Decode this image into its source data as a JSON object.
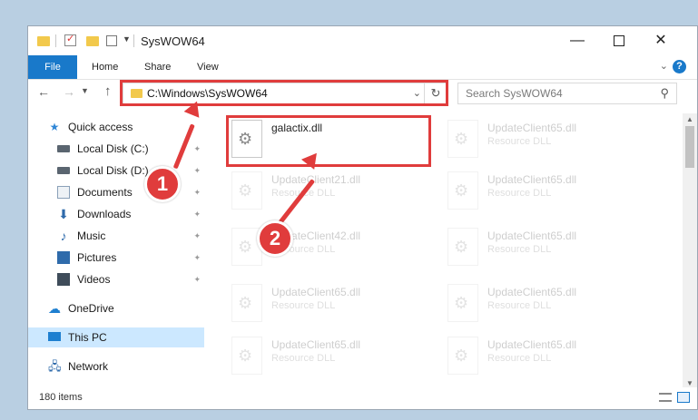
{
  "window": {
    "title": "SysWOW64"
  },
  "ribbon": {
    "tabs": [
      "File",
      "Home",
      "Share",
      "View"
    ],
    "help": "?"
  },
  "address": {
    "path": "C:\\Windows\\SysWOW64"
  },
  "search": {
    "placeholder": "Search SysWOW64"
  },
  "sidebar": {
    "quick_access": "Quick access",
    "items": [
      {
        "label": "Local Disk (C:)",
        "icon": "drive-icon"
      },
      {
        "label": "Local Disk (D:)",
        "icon": "drive-icon"
      },
      {
        "label": "Documents",
        "icon": "documents-icon"
      },
      {
        "label": "Downloads",
        "icon": "download-icon"
      },
      {
        "label": "Music",
        "icon": "music-icon"
      },
      {
        "label": "Pictures",
        "icon": "pictures-icon"
      },
      {
        "label": "Videos",
        "icon": "videos-icon"
      }
    ],
    "onedrive": "OneDrive",
    "this_pc": "This PC",
    "network": "Network"
  },
  "files": {
    "left": [
      {
        "name": "galactix.dll",
        "type": ""
      },
      {
        "name": "UpdateClient21.dll",
        "type": "Resource DLL"
      },
      {
        "name": "UpdateClient42.dll",
        "type": "Resource DLL"
      },
      {
        "name": "UpdateClient65.dll",
        "type": "Resource DLL"
      },
      {
        "name": "UpdateClient65.dll",
        "type": "Resource DLL"
      }
    ],
    "right": [
      {
        "name": "UpdateClient65.dll",
        "type": "Resource DLL"
      },
      {
        "name": "UpdateClient65.dll",
        "type": "Resource DLL"
      },
      {
        "name": "UpdateClient65.dll",
        "type": "Resource DLL"
      },
      {
        "name": "UpdateClient65.dll",
        "type": "Resource DLL"
      },
      {
        "name": "UpdateClient65.dll",
        "type": "Resource DLL"
      }
    ]
  },
  "annotations": {
    "step1": "1",
    "step2": "2",
    "color": "#e03c3c"
  },
  "status": {
    "items_count": "180 items"
  },
  "colors": {
    "accent": "#1979ca",
    "selection": "#cce8ff",
    "folder": "#f2c94c"
  }
}
